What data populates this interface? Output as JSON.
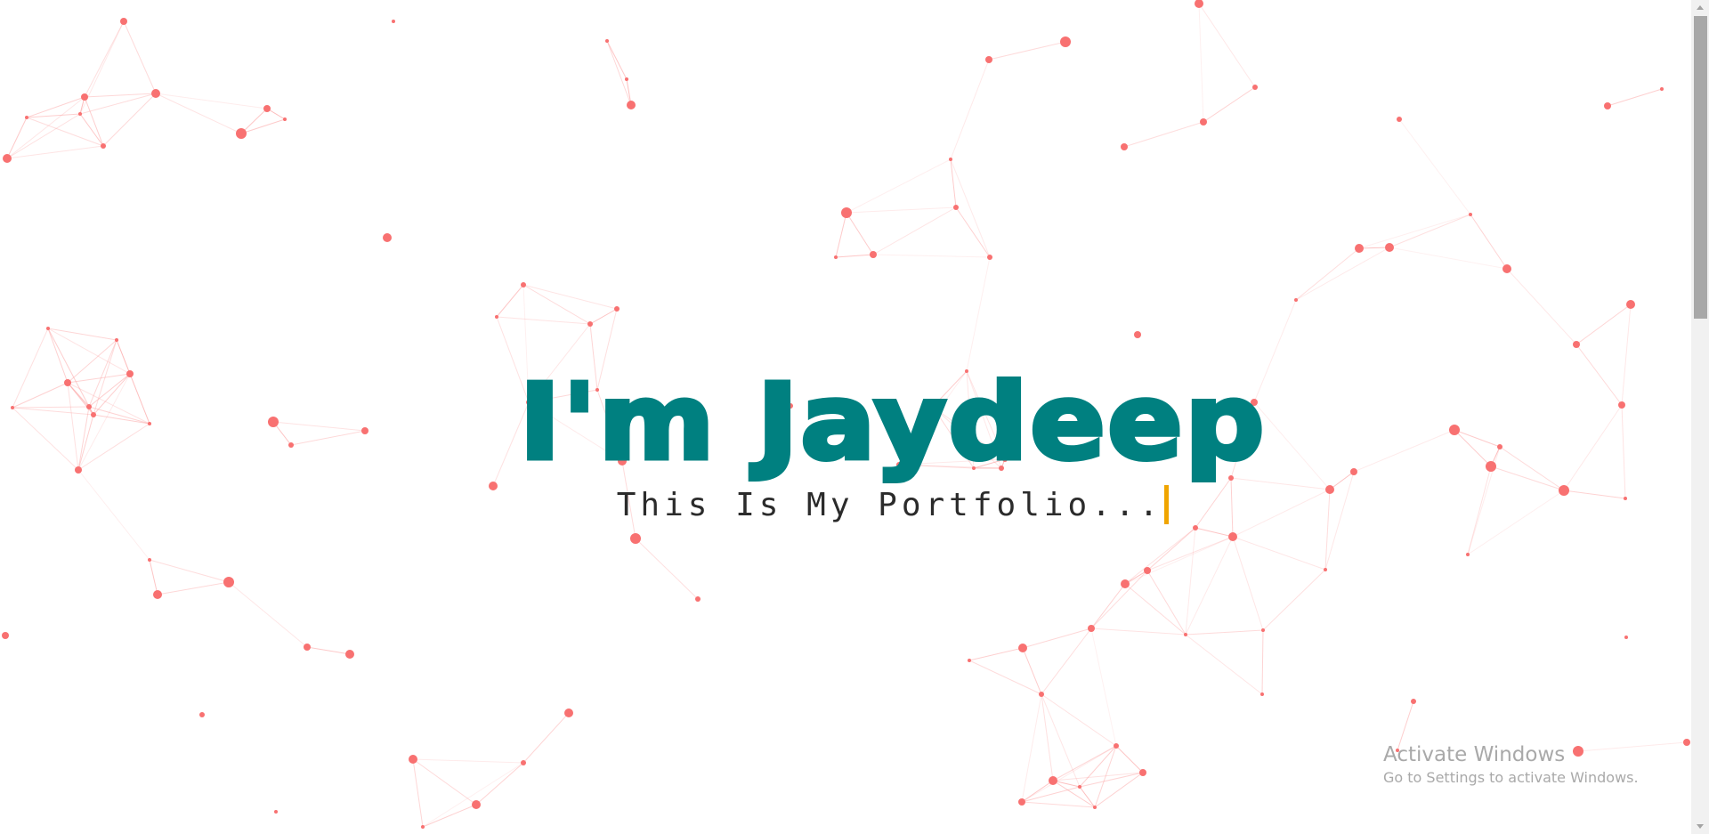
{
  "hero": {
    "title": "I'm Jaydeep",
    "subtitle": "This Is My Portfolio..."
  },
  "watermark": {
    "title": "Activate Windows",
    "subtitle": "Go to Settings to activate Windows."
  },
  "colors": {
    "background": "#ffffff",
    "title": "#008080",
    "subtitle": "#2b2b2b",
    "caret": "#f0a500",
    "particle": "#f87171",
    "link": "#fca5a5",
    "watermark": "#a9a9a9"
  },
  "background_effect": "particle-network"
}
